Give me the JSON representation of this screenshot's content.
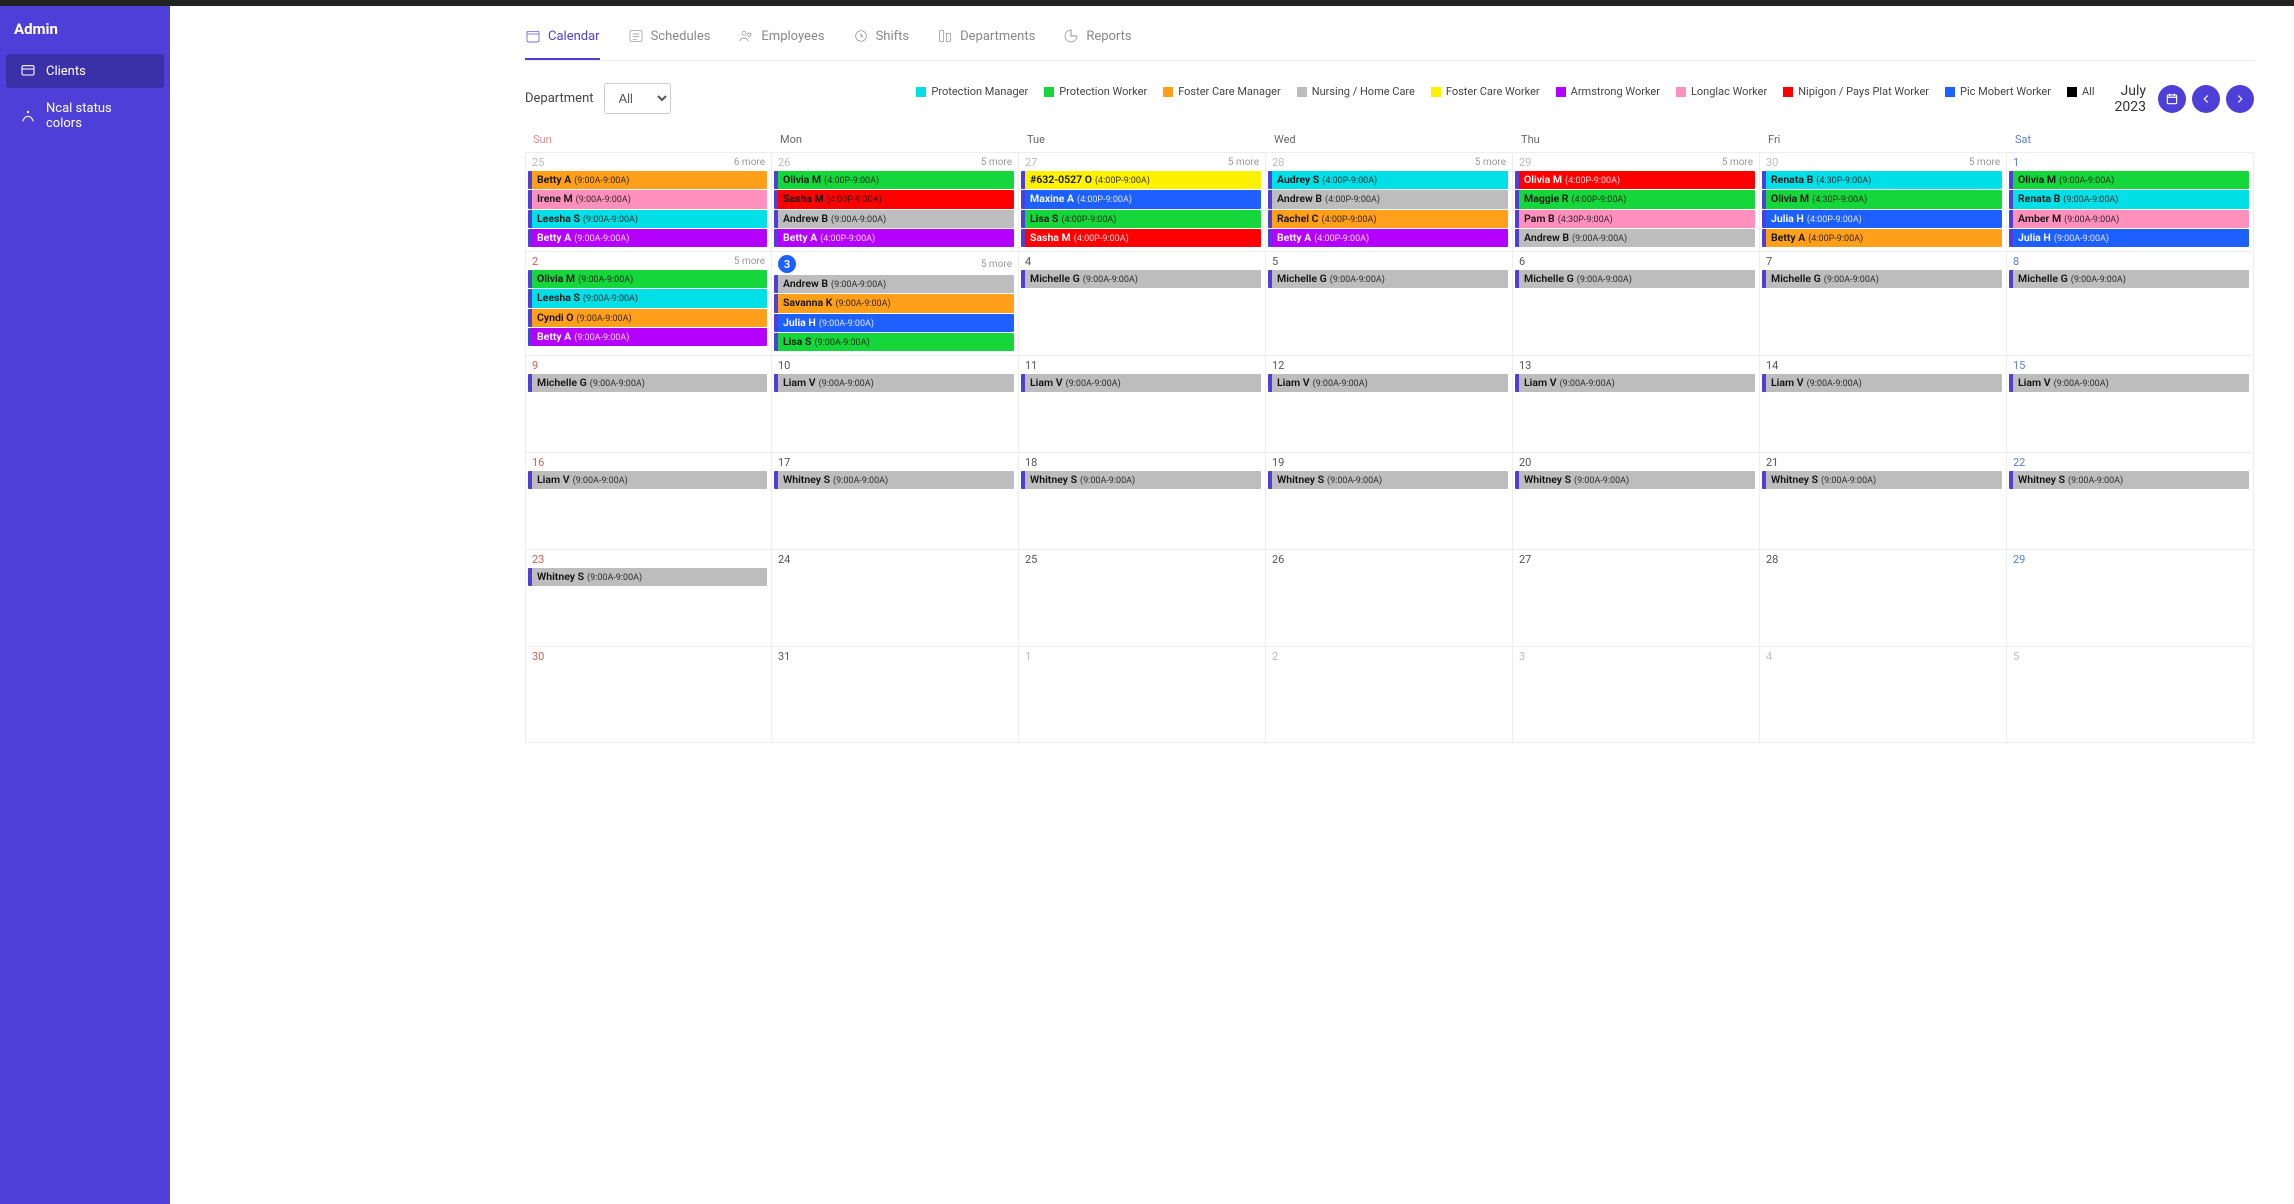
{
  "sidebar": {
    "title": "Admin",
    "items": [
      {
        "label": "Clients",
        "active": true
      },
      {
        "label": "Ncal status colors",
        "active": false
      }
    ]
  },
  "tabs": [
    {
      "label": "Calendar",
      "icon": "calendar",
      "active": true
    },
    {
      "label": "Schedules",
      "icon": "schedules"
    },
    {
      "label": "Employees",
      "icon": "employees"
    },
    {
      "label": "Shifts",
      "icon": "shifts"
    },
    {
      "label": "Departments",
      "icon": "departments"
    },
    {
      "label": "Reports",
      "icon": "reports"
    }
  ],
  "department": {
    "label": "Department",
    "selected": "All",
    "options": [
      "All"
    ]
  },
  "legend": [
    {
      "label": "Protection Manager",
      "color": "#00e0e6"
    },
    {
      "label": "Protection Worker",
      "color": "#15d63a"
    },
    {
      "label": "Foster Care Manager",
      "color": "#ff9f1a"
    },
    {
      "label": "Nursing / Home Care",
      "color": "#bdbdbd"
    },
    {
      "label": "Foster Care Worker",
      "color": "#fff200"
    },
    {
      "label": "Armstrong Worker",
      "color": "#b400ff"
    },
    {
      "label": "Longlac Worker",
      "color": "#ff8fbd"
    },
    {
      "label": "Nipigon / Pays Plat Worker",
      "color": "#ff0000"
    },
    {
      "label": "Pic Mobert Worker",
      "color": "#1e5fff"
    },
    {
      "label": "All",
      "color": "#000000"
    }
  ],
  "period": {
    "month": "July",
    "year": "2023"
  },
  "moreSuffix": " more",
  "dow": [
    "Sun",
    "Mon",
    "Tue",
    "Wed",
    "Thu",
    "Fri",
    "Sat"
  ],
  "colors": {
    "pm": "#00e0e6",
    "pw": "#15d63a",
    "fcm": "#ff9f1a",
    "nhc": "#bdbdbd",
    "fcw": "#fff200",
    "arm": "#b400ff",
    "ll": "#ff8fbd",
    "nip": "#ff0000",
    "pmo": "#1e5fff",
    "all": "#000000"
  },
  "weeks": [
    [
      {
        "num": "25",
        "cls": "muted",
        "more": 6,
        "events": [
          {
            "name": "Betty A",
            "time": "(9:00A-9:00A)",
            "c": "fcm",
            "fg": "black"
          },
          {
            "name": "Irene M",
            "time": "(9:00A-9:00A)",
            "c": "ll",
            "fg": "black"
          },
          {
            "name": "Leesha S",
            "time": "(9:00A-9:00A)",
            "c": "pm",
            "fg": "black"
          },
          {
            "name": "Betty A",
            "time": "(9:00A-9:00A)",
            "c": "arm",
            "fg": "white"
          }
        ]
      },
      {
        "num": "26",
        "cls": "muted",
        "more": 5,
        "events": [
          {
            "name": "Olivia M",
            "time": "(4:00P-9:00A)",
            "c": "pw",
            "fg": "black"
          },
          {
            "name": "Sasha M",
            "time": "(4:00P-9:00A)",
            "c": "nip",
            "fg": "black"
          },
          {
            "name": "Andrew B",
            "time": "(9:00A-9:00A)",
            "c": "nhc",
            "fg": "black"
          },
          {
            "name": "Betty A",
            "time": "(4:00P-9:00A)",
            "c": "arm",
            "fg": "white"
          }
        ]
      },
      {
        "num": "27",
        "cls": "muted",
        "more": 5,
        "events": [
          {
            "name": "#632-0527 O",
            "time": "(4:00P-9:00A)",
            "c": "fcw",
            "fg": "black"
          },
          {
            "name": "Maxine A",
            "time": "(4:00P-9:00A)",
            "c": "pmo",
            "fg": "white"
          },
          {
            "name": "Lisa S",
            "time": "(4:00P-9:00A)",
            "c": "pw",
            "fg": "black"
          },
          {
            "name": "Sasha M",
            "time": "(4:00P-9:00A)",
            "c": "nip",
            "fg": "white"
          }
        ]
      },
      {
        "num": "28",
        "cls": "muted",
        "more": 5,
        "events": [
          {
            "name": "Audrey S",
            "time": "(4:00P-9:00A)",
            "c": "pm",
            "fg": "black"
          },
          {
            "name": "Andrew B",
            "time": "(4:00P-9:00A)",
            "c": "nhc",
            "fg": "black"
          },
          {
            "name": "Rachel C",
            "time": "(4:00P-9:00A)",
            "c": "fcm",
            "fg": "black"
          },
          {
            "name": "Betty A",
            "time": "(4:00P-9:00A)",
            "c": "arm",
            "fg": "white"
          }
        ]
      },
      {
        "num": "29",
        "cls": "muted",
        "more": 5,
        "events": [
          {
            "name": "Olivia M",
            "time": "(4:00P-9:00A)",
            "c": "nip",
            "fg": "white"
          },
          {
            "name": "Maggie R",
            "time": "(4:00P-9:00A)",
            "c": "pw",
            "fg": "black"
          },
          {
            "name": "Pam B",
            "time": "(4:30P-9:00A)",
            "c": "ll",
            "fg": "black"
          },
          {
            "name": "Andrew B",
            "time": "(9:00A-9:00A)",
            "c": "nhc",
            "fg": "black"
          }
        ]
      },
      {
        "num": "30",
        "cls": "muted",
        "more": 5,
        "events": [
          {
            "name": "Renata B",
            "time": "(4:30P-9:00A)",
            "c": "pm",
            "fg": "black"
          },
          {
            "name": "Olivia M",
            "time": "(4:30P-9:00A)",
            "c": "pw",
            "fg": "black"
          },
          {
            "name": "Julia H",
            "time": "(4:00P-9:00A)",
            "c": "pmo",
            "fg": "white"
          },
          {
            "name": "Betty A",
            "time": "(4:00P-9:00A)",
            "c": "fcm",
            "fg": "black"
          }
        ]
      },
      {
        "num": "1",
        "cls": "sat",
        "events": [
          {
            "name": "Olivia M",
            "time": "(9:00A-9:00A)",
            "c": "pw",
            "fg": "black"
          },
          {
            "name": "Renata B",
            "time": "(9:00A-9:00A)",
            "c": "pm",
            "fg": "black"
          },
          {
            "name": "Amber M",
            "time": "(9:00A-9:00A)",
            "c": "ll",
            "fg": "black"
          },
          {
            "name": "Julia H",
            "time": "(9:00A-9:00A)",
            "c": "pmo",
            "fg": "white"
          }
        ]
      }
    ],
    [
      {
        "num": "2",
        "cls": "sun",
        "more": 5,
        "events": [
          {
            "name": "Olivia M",
            "time": "(9:00A-9:00A)",
            "c": "pw",
            "fg": "black"
          },
          {
            "name": "Leesha S",
            "time": "(9:00A-9:00A)",
            "c": "pm",
            "fg": "black"
          },
          {
            "name": "Cyndi O",
            "time": "(9:00A-9:00A)",
            "c": "fcm",
            "fg": "black"
          },
          {
            "name": "Betty A",
            "time": "(9:00A-9:00A)",
            "c": "arm",
            "fg": "white"
          }
        ]
      },
      {
        "num": "3",
        "cls": "today",
        "more": 5,
        "events": [
          {
            "name": "Andrew B",
            "time": "(9:00A-9:00A)",
            "c": "nhc",
            "fg": "black"
          },
          {
            "name": "Savanna K",
            "time": "(9:00A-9:00A)",
            "c": "fcm",
            "fg": "black"
          },
          {
            "name": "Julia H",
            "time": "(9:00A-9:00A)",
            "c": "pmo",
            "fg": "white"
          },
          {
            "name": "Lisa S",
            "time": "(9:00A-9:00A)",
            "c": "pw",
            "fg": "black"
          }
        ]
      },
      {
        "num": "4",
        "events": [
          {
            "name": "Michelle G",
            "time": "(9:00A-9:00A)",
            "c": "nhc",
            "fg": "black"
          }
        ]
      },
      {
        "num": "5",
        "events": [
          {
            "name": "Michelle G",
            "time": "(9:00A-9:00A)",
            "c": "nhc",
            "fg": "black"
          }
        ]
      },
      {
        "num": "6",
        "events": [
          {
            "name": "Michelle G",
            "time": "(9:00A-9:00A)",
            "c": "nhc",
            "fg": "black"
          }
        ]
      },
      {
        "num": "7",
        "events": [
          {
            "name": "Michelle G",
            "time": "(9:00A-9:00A)",
            "c": "nhc",
            "fg": "black"
          }
        ]
      },
      {
        "num": "8",
        "cls": "sat",
        "events": [
          {
            "name": "Michelle G",
            "time": "(9:00A-9:00A)",
            "c": "nhc",
            "fg": "black"
          }
        ]
      }
    ],
    [
      {
        "num": "9",
        "cls": "sun",
        "events": [
          {
            "name": "Michelle G",
            "time": "(9:00A-9:00A)",
            "c": "nhc",
            "fg": "black"
          }
        ]
      },
      {
        "num": "10",
        "events": [
          {
            "name": "Liam V",
            "time": "(9:00A-9:00A)",
            "c": "nhc",
            "fg": "black"
          }
        ]
      },
      {
        "num": "11",
        "events": [
          {
            "name": "Liam V",
            "time": "(9:00A-9:00A)",
            "c": "nhc",
            "fg": "black"
          }
        ]
      },
      {
        "num": "12",
        "events": [
          {
            "name": "Liam V",
            "time": "(9:00A-9:00A)",
            "c": "nhc",
            "fg": "black"
          }
        ]
      },
      {
        "num": "13",
        "events": [
          {
            "name": "Liam V",
            "time": "(9:00A-9:00A)",
            "c": "nhc",
            "fg": "black"
          }
        ]
      },
      {
        "num": "14",
        "events": [
          {
            "name": "Liam V",
            "time": "(9:00A-9:00A)",
            "c": "nhc",
            "fg": "black"
          }
        ]
      },
      {
        "num": "15",
        "cls": "sat",
        "events": [
          {
            "name": "Liam V",
            "time": "(9:00A-9:00A)",
            "c": "nhc",
            "fg": "black"
          }
        ]
      }
    ],
    [
      {
        "num": "16",
        "cls": "sun",
        "events": [
          {
            "name": "Liam V",
            "time": "(9:00A-9:00A)",
            "c": "nhc",
            "fg": "black"
          }
        ]
      },
      {
        "num": "17",
        "events": [
          {
            "name": "Whitney S",
            "time": "(9:00A-9:00A)",
            "c": "nhc",
            "fg": "black"
          }
        ]
      },
      {
        "num": "18",
        "events": [
          {
            "name": "Whitney S",
            "time": "(9:00A-9:00A)",
            "c": "nhc",
            "fg": "black"
          }
        ]
      },
      {
        "num": "19",
        "events": [
          {
            "name": "Whitney S",
            "time": "(9:00A-9:00A)",
            "c": "nhc",
            "fg": "black"
          }
        ]
      },
      {
        "num": "20",
        "events": [
          {
            "name": "Whitney S",
            "time": "(9:00A-9:00A)",
            "c": "nhc",
            "fg": "black"
          }
        ]
      },
      {
        "num": "21",
        "events": [
          {
            "name": "Whitney S",
            "time": "(9:00A-9:00A)",
            "c": "nhc",
            "fg": "black"
          }
        ]
      },
      {
        "num": "22",
        "cls": "sat",
        "events": [
          {
            "name": "Whitney S",
            "time": "(9:00A-9:00A)",
            "c": "nhc",
            "fg": "black"
          }
        ]
      }
    ],
    [
      {
        "num": "23",
        "cls": "sun",
        "events": [
          {
            "name": "Whitney S",
            "time": "(9:00A-9:00A)",
            "c": "nhc",
            "fg": "black"
          }
        ]
      },
      {
        "num": "24",
        "events": []
      },
      {
        "num": "25",
        "events": []
      },
      {
        "num": "26",
        "events": []
      },
      {
        "num": "27",
        "events": []
      },
      {
        "num": "28",
        "events": []
      },
      {
        "num": "29",
        "cls": "sat",
        "events": []
      }
    ],
    [
      {
        "num": "30",
        "cls": "sun",
        "events": []
      },
      {
        "num": "31",
        "events": []
      },
      {
        "num": "1",
        "cls": "muted",
        "events": []
      },
      {
        "num": "2",
        "cls": "muted",
        "events": []
      },
      {
        "num": "3",
        "cls": "muted",
        "events": []
      },
      {
        "num": "4",
        "cls": "muted",
        "events": []
      },
      {
        "num": "5",
        "cls": "muted",
        "events": []
      }
    ]
  ]
}
